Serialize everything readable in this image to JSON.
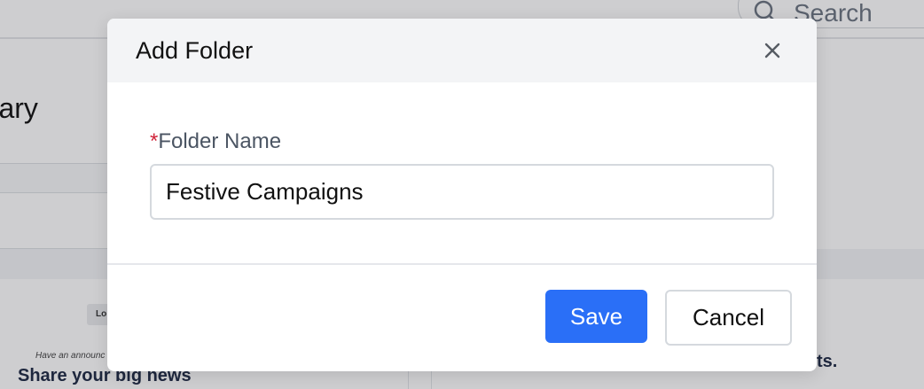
{
  "background": {
    "search_placeholder": "Search",
    "page_title_fragment": "brary",
    "logo_chip_text": "Lo",
    "announce_text": "Have an announc",
    "card_heading": "Share your big news",
    "right_card_text": "ts."
  },
  "modal": {
    "title": "Add Folder",
    "close_icon": "close-icon",
    "field": {
      "required_marker": "*",
      "label": "Folder Name",
      "value": "Festive Campaigns"
    },
    "save_label": "Save",
    "cancel_label": "Cancel"
  },
  "colors": {
    "primary": "#2a6ff7",
    "required": "#d0243a",
    "header_bg": "#f3f4f6"
  }
}
